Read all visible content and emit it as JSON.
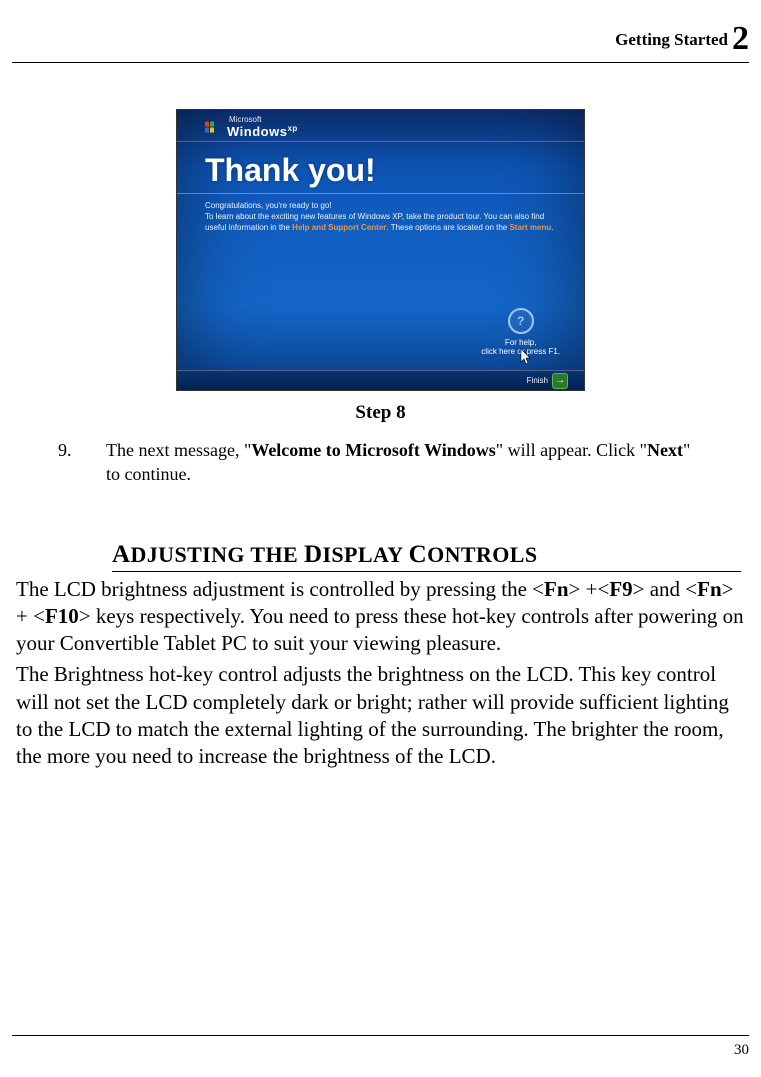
{
  "header": {
    "title": "Getting Started",
    "chapter_number": "2"
  },
  "screenshot": {
    "brand_ms": "Microsoft",
    "brand_name": "Windows",
    "brand_suffix": "xp",
    "heading": "Thank you!",
    "line1": "Congratulations, you're ready to go!",
    "line2_a": "To learn about the exciting new features of Windows XP, take the product tour. You can also find useful information in the ",
    "line2_hl1": "Help and Support Center",
    "line2_b": ". These options are located on the ",
    "line2_hl2": "Start menu",
    "line2_c": ".",
    "help_label": "For help,",
    "help_sub": "click here or press F1.",
    "help_q": "?",
    "finish": "Finish",
    "arrow": "→"
  },
  "caption": "Step 8",
  "step9": {
    "num": "9.",
    "pre": "The next message, \"",
    "bold1": "Welcome to Microsoft Windows",
    "mid": "\" will appear. Click \"",
    "bold2": "Next",
    "post": "\" to continue."
  },
  "section_heading_parts": {
    "a_cap": "A",
    "a_rest": "DJUSTING THE ",
    "d_cap": "D",
    "d_rest": "ISPLAY ",
    "c_cap": "C",
    "c_rest": "ONTROLS"
  },
  "para1": {
    "t1": "The LCD brightness adjustment is controlled by pressing the <",
    "b1": "Fn",
    "t2": "> +<",
    "b2": "F9",
    "t3": "> and <",
    "b3": "Fn",
    "t4": "> + <",
    "b4": "F10",
    "t5": "> keys respectively. You need to press these hot-key controls after powering on your Convertible Tablet PC to suit your viewing pleasure."
  },
  "para2": "The Brightness hot-key control adjusts the brightness on the LCD. This key control will not set the LCD completely dark or bright; rather will provide sufficient lighting to the LCD to match the external lighting of the surrounding. The brighter the room, the more you need to increase the brightness of the LCD.",
  "footer": {
    "page": "30"
  }
}
